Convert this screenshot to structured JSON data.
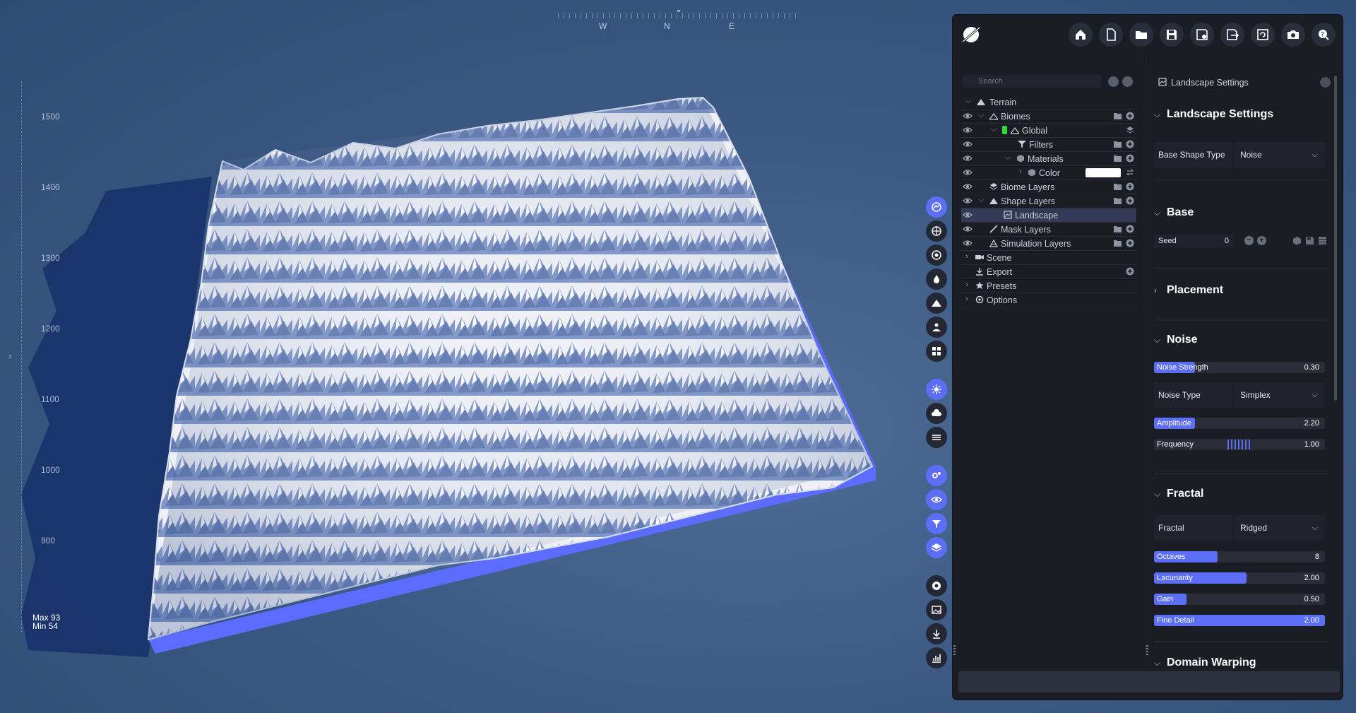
{
  "viewport": {
    "compass": {
      "w": "W",
      "n": "N",
      "e": "E"
    },
    "ruler_labels": [
      "1500",
      "1400",
      "1300",
      "1200",
      "1100",
      "1000",
      "900"
    ],
    "max_label": "Max 93",
    "min_label": "Min 54"
  },
  "toolbar": {
    "buttons": [
      "home-icon",
      "new-file-icon",
      "open-folder-icon",
      "save-icon",
      "save-as-icon",
      "export-icon",
      "refresh-icon",
      "camera-icon",
      "help-icon"
    ],
    "accent": "#5c6ef5"
  },
  "tree": {
    "search_placeholder": "Search",
    "items": [
      {
        "label": "Terrain"
      },
      {
        "label": "Biomes"
      },
      {
        "label": "Global"
      },
      {
        "label": "Filters"
      },
      {
        "label": "Materials"
      },
      {
        "label": "Color"
      },
      {
        "label": "Biome Layers"
      },
      {
        "label": "Shape Layers"
      },
      {
        "label": "Landscape"
      },
      {
        "label": "Mask Layers"
      },
      {
        "label": "Simulation Layers"
      },
      {
        "label": "Scene"
      },
      {
        "label": "Export"
      },
      {
        "label": "Presets"
      },
      {
        "label": "Options"
      }
    ]
  },
  "settings": {
    "header": "Landscape Settings",
    "sections": {
      "landscape": "Landscape Settings",
      "base": "Base",
      "placement": "Placement",
      "noise": "Noise",
      "fractal": "Fractal",
      "domain_warping": "Domain Warping"
    },
    "base_shape_type": {
      "label": "Base Shape Type",
      "value": "Noise"
    },
    "seed": {
      "label": "Seed",
      "value": "0"
    },
    "noise_strength": {
      "label": "Noise Strength",
      "value": "0.30",
      "fraction": 0.24
    },
    "noise_type": {
      "label": "Noise Type",
      "value": "Simplex"
    },
    "amplitude": {
      "label": "Amplitude",
      "value": "2.20",
      "fraction": 0.24
    },
    "frequency": {
      "label": "Frequency",
      "value": "1.00"
    },
    "fractal": {
      "label": "Fractal",
      "value": "Ridged"
    },
    "octaves": {
      "label": "Octaves",
      "value": "8",
      "fraction": 0.37
    },
    "lacunarity": {
      "label": "Lacunarity",
      "value": "2.00",
      "fraction": 0.54
    },
    "gain": {
      "label": "Gain",
      "value": "0.50",
      "fraction": 0.19
    },
    "fine_detail": {
      "label": "Fine Detail",
      "value": "2.00",
      "fraction": 1.0
    }
  }
}
